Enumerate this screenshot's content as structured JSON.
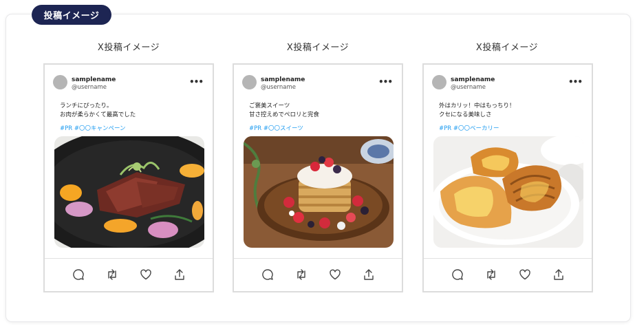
{
  "section_label": "投稿イメージ",
  "posts": [
    {
      "column_title": "X投稿イメージ",
      "name": "samplename",
      "handle": "@username",
      "more": "•••",
      "text_line1": "ランチにぴったり。",
      "text_line2": "お肉が柔らかくて最高でした",
      "hashtags": "#PR #〇〇キャンペーン",
      "image": "roast-duck-dish-photo"
    },
    {
      "column_title": "X投稿イメージ",
      "name": "samplename",
      "handle": "@username",
      "more": "•••",
      "text_line1": "ご褒美スイーツ",
      "text_line2": "甘さ控えめでペロリと完食",
      "hashtags": "#PR #〇〇スイーツ",
      "image": "berry-pancakes-photo"
    },
    {
      "column_title": "X投稿イメージ",
      "name": "samplename",
      "handle": "@username",
      "more": "•••",
      "text_line1": "外はカリッ！中はもっちり！",
      "text_line2": "クセになる美味しさ",
      "hashtags": "#PR #〇〇ベーカリー",
      "image": "pastries-photo"
    }
  ],
  "actions": [
    "reply-icon",
    "repost-icon",
    "like-icon",
    "share-icon"
  ],
  "colors": {
    "pill": "#1d2553",
    "hashtag": "#1d9bf0",
    "card_border": "#dcdcdc"
  }
}
